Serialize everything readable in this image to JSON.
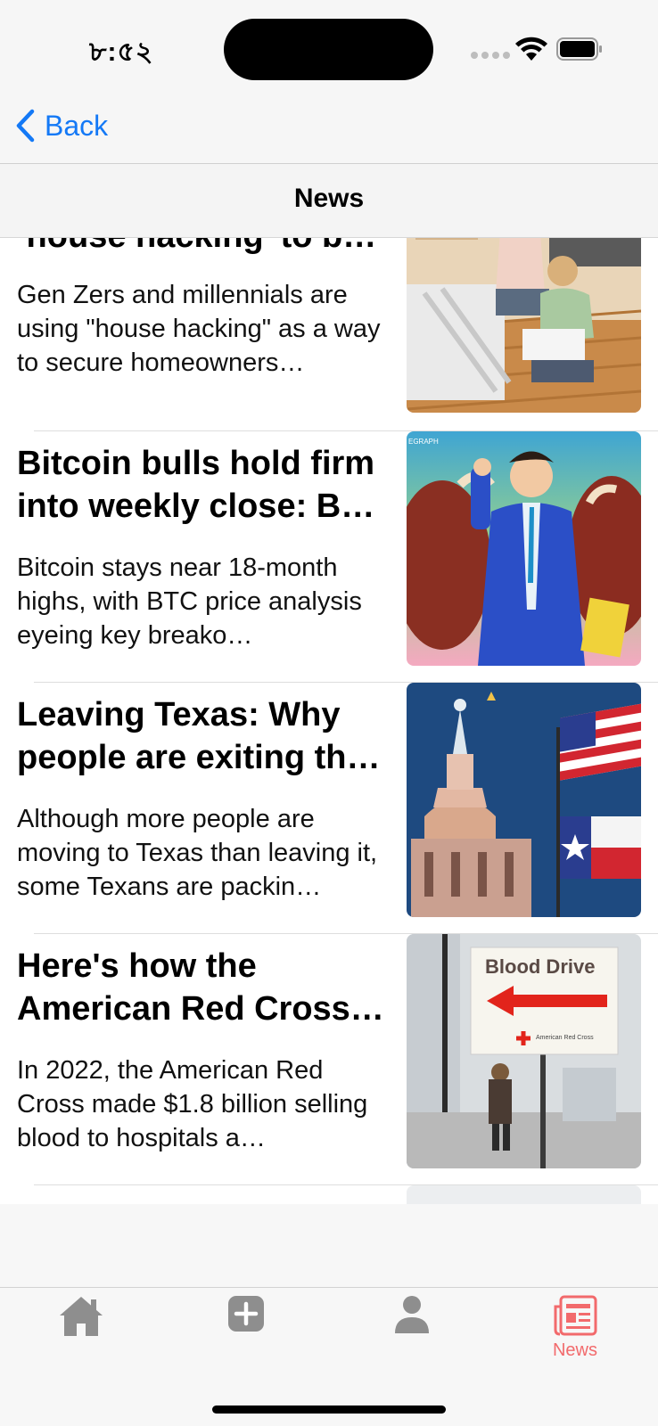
{
  "status_bar": {
    "time": "৮:৫২"
  },
  "nav": {
    "back_label": "Back"
  },
  "page": {
    "title": "News"
  },
  "articles": [
    {
      "headline": "‘house hacking’ to b…",
      "summary": "Gen Zers and millennials are using \"house hacking\" as a way to secure homeowners…",
      "image": "couple-with-moving-boxes"
    },
    {
      "headline": "Bitcoin bulls hold firm into weekly close: B…",
      "summary": "Bitcoin stays near 18-month highs, with BTC price analysis eyeing key breako…",
      "image": "bitcoin-bull-illustration",
      "image_text": "EGRAPH"
    },
    {
      "headline": "Leaving Texas: Why people are exiting th…",
      "summary": "Although more people are moving to Texas than leaving it, some Texans are packin…",
      "image": "texas-capitol-flags"
    },
    {
      "headline": "Here's how the American Red Cross…",
      "summary": "In 2022, the American Red Cross made $1.8 billion selling blood to hospitals a…",
      "image": "blood-drive-sign",
      "image_text": {
        "sign": "Blood Drive",
        "org": "American Red Cross"
      }
    }
  ],
  "tab_bar": {
    "tabs": [
      {
        "icon": "house-icon",
        "label": ""
      },
      {
        "icon": "plus-square-icon",
        "label": ""
      },
      {
        "icon": "person-icon",
        "label": ""
      },
      {
        "icon": "newspaper-icon",
        "label": "News",
        "active": true
      }
    ],
    "active_color": "#f26a6c",
    "inactive_color": "#8e8e8e"
  },
  "colors": {
    "accent": "#1479f6"
  }
}
